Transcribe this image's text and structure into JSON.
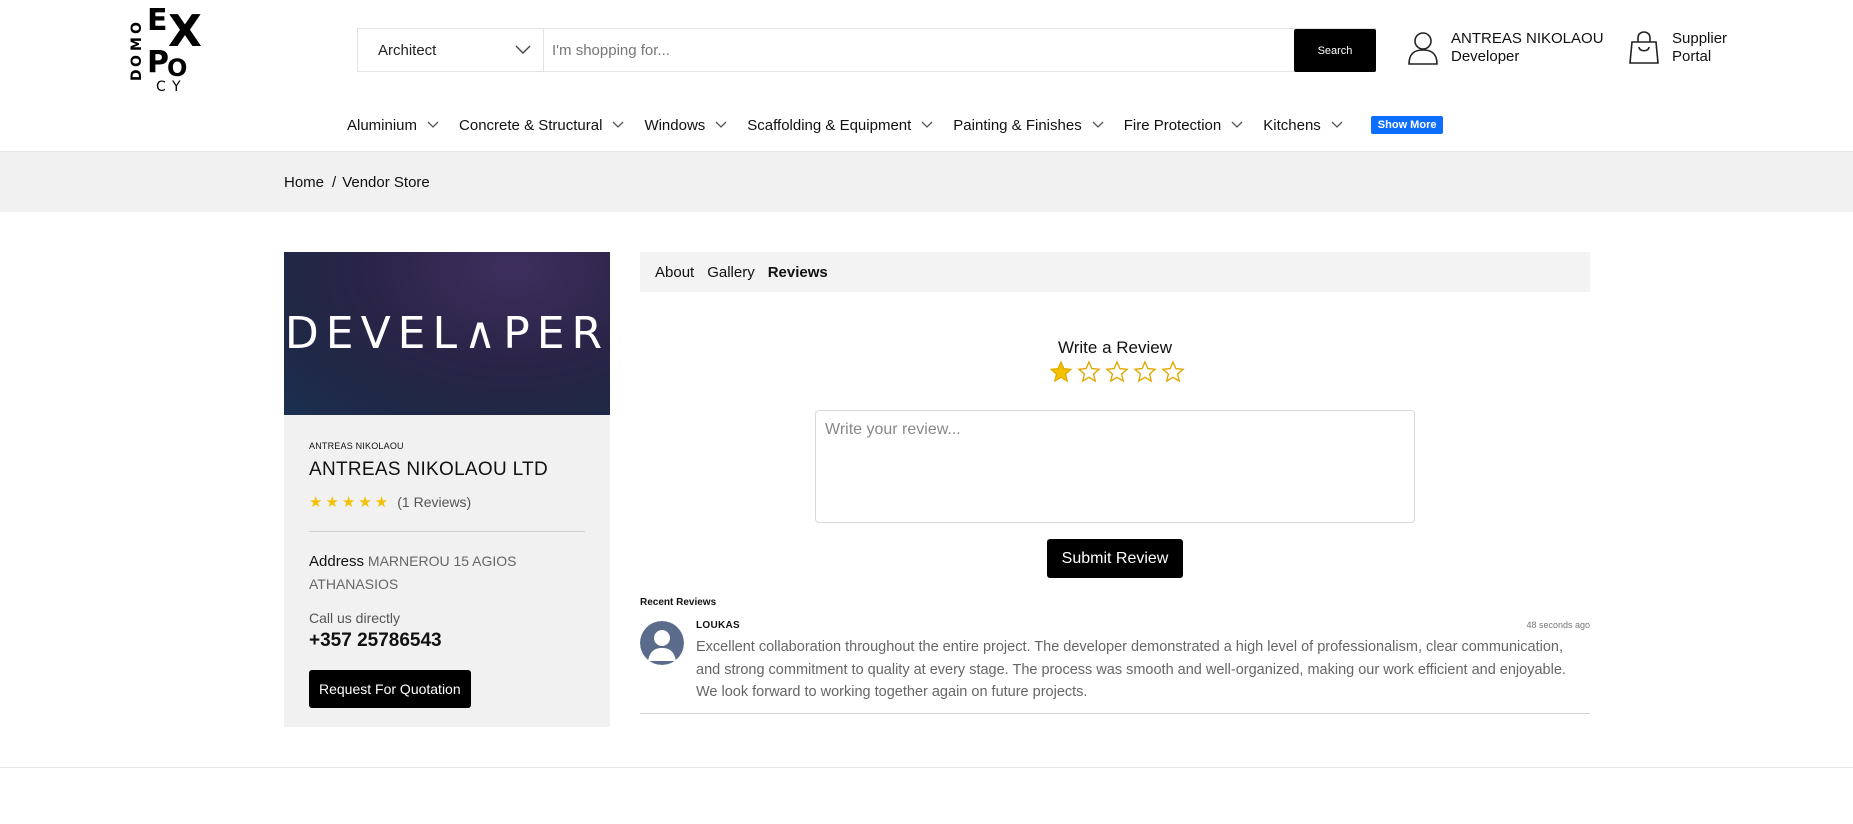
{
  "brand": {
    "logo_letters": [
      "D",
      "O",
      "M",
      "O",
      "E",
      "X",
      "P",
      "O",
      "C",
      "Y"
    ],
    "logo_text": "DOMO EXPO CY"
  },
  "search": {
    "category": "Architect",
    "placeholder": "I'm shopping for...",
    "button": "Search"
  },
  "account": {
    "name": "ANTREAS NIKOLAOU",
    "role": "Developer",
    "icon": "user-icon"
  },
  "supplier": {
    "line1": "Supplier",
    "line2": "Portal",
    "icon": "shopping-bag-icon"
  },
  "nav": {
    "items": [
      "Aluminium",
      "Concrete & Structural",
      "Windows",
      "Scaffolding & Equipment",
      "Painting & Finishes",
      "Fire Protection",
      "Kitchens"
    ],
    "show_more": "Show More"
  },
  "breadcrumb": {
    "home": "Home",
    "separator": "/",
    "current": "Vendor Store"
  },
  "vendor": {
    "banner_text": "DEVEL∧PER",
    "owner": "ANTREAS NIKOLAOU",
    "company": "ANTREAS NIKOLAOU LTD",
    "rating_stars": 5,
    "review_count": "(1 Reviews)",
    "address_label": "Address",
    "address": "MARNEROU 15 AGIOS ATHANASIOS",
    "call_label": "Call us directly",
    "phone": "+357 25786543",
    "quote_button": "Request For Quotation"
  },
  "tabs": [
    "About",
    "Gallery",
    "Reviews"
  ],
  "active_tab": "Reviews",
  "review_form": {
    "title": "Write a Review",
    "selected_stars": 1,
    "max_stars": 5,
    "placeholder": "Write your review...",
    "submit": "Submit Review"
  },
  "recent": {
    "label": "Recent Reviews",
    "items": [
      {
        "name": "LOUKAS",
        "time": "48 seconds ago",
        "text": "Excellent collaboration throughout the entire project. The developer demonstrated a high level of professionalism, clear communication, and strong commitment to quality at every stage. The process was smooth and well-organized, making our work efficient and enjoyable. We look forward to working together again on future projects."
      }
    ]
  },
  "colors": {
    "accent": "#0d6efd",
    "star": "#f2c200",
    "button": "#000000",
    "panel": "#f1f1f1"
  }
}
